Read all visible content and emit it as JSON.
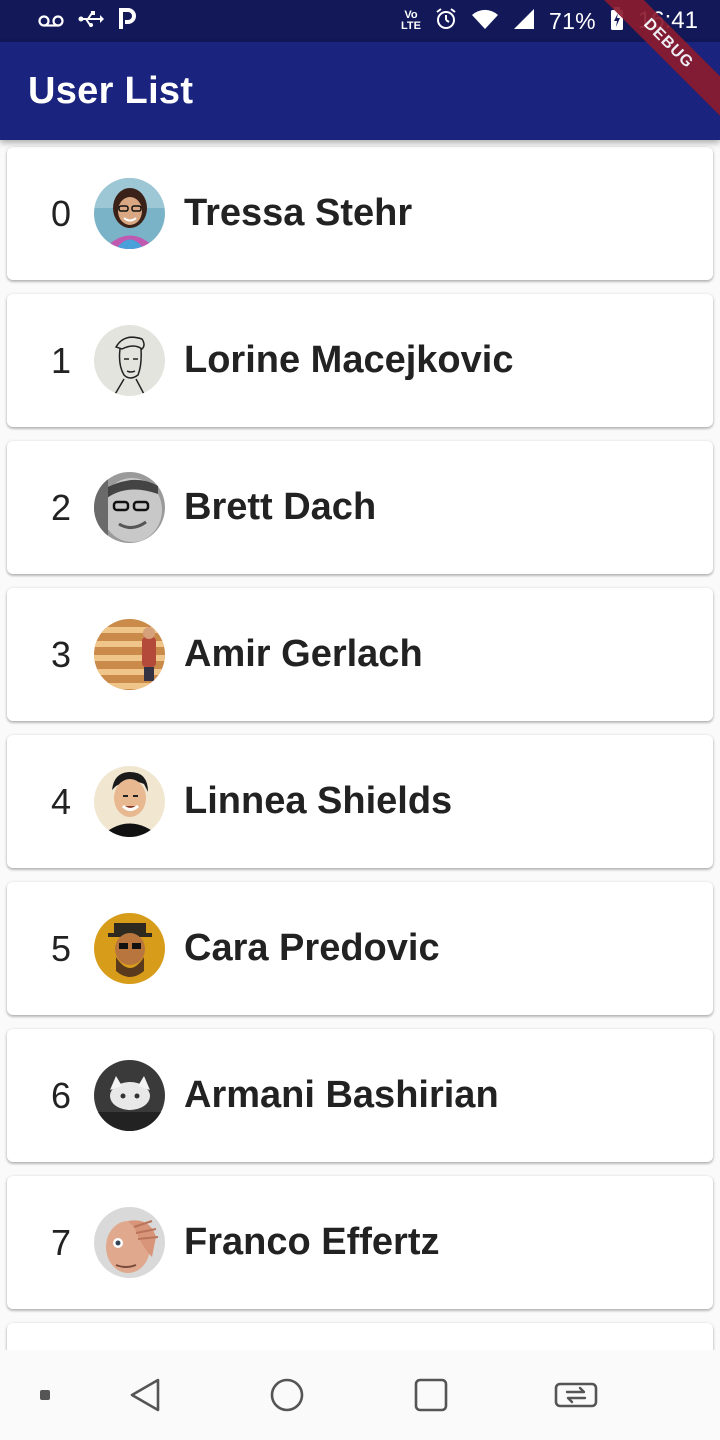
{
  "status_bar": {
    "left_icons": [
      "voicemail-icon",
      "usb-icon",
      "parking-icon"
    ],
    "volte_top": "Vo",
    "volte_bottom": "LTE",
    "battery_percent": "71%",
    "time": "16:41"
  },
  "app_bar": {
    "title": "User List"
  },
  "debug_banner": {
    "label": "DEBUG"
  },
  "colors": {
    "status_bar": "#121858",
    "app_bar": "#1a237e",
    "debug_ribbon": "#8b1c2f",
    "card": "#ffffff",
    "background": "#fafafa",
    "text": "#222222"
  },
  "users": [
    {
      "index": "0",
      "name": "Tressa Stehr"
    },
    {
      "index": "1",
      "name": "Lorine Macejkovic"
    },
    {
      "index": "2",
      "name": "Brett Dach"
    },
    {
      "index": "3",
      "name": "Amir Gerlach"
    },
    {
      "index": "4",
      "name": "Linnea Shields"
    },
    {
      "index": "5",
      "name": "Cara Predovic"
    },
    {
      "index": "6",
      "name": "Armani Bashirian"
    },
    {
      "index": "7",
      "name": "Franco Effertz"
    }
  ],
  "nav_bar": {
    "items": [
      "menu-dot-icon",
      "back-icon",
      "home-icon",
      "recents-icon",
      "rotate-icon"
    ]
  }
}
